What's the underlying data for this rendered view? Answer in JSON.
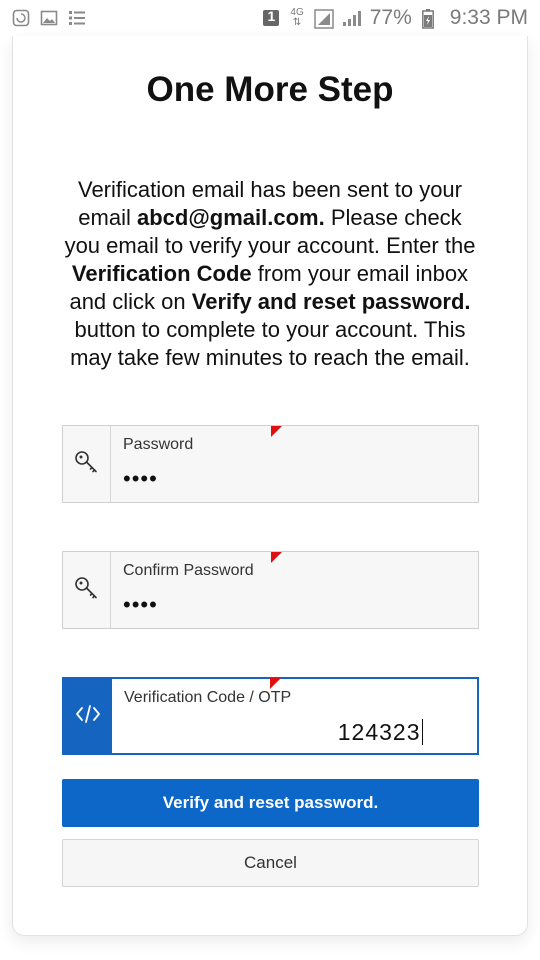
{
  "status_bar": {
    "network": "4G",
    "battery": "77%",
    "time": "9:33 PM",
    "notification_badge": "1",
    "icons": [
      "screenshot-icon",
      "gallery-icon",
      "list-icon",
      "notification-badge-icon",
      "network-4g-icon",
      "signal-icon",
      "battery-icon"
    ]
  },
  "page": {
    "title": "One More Step",
    "message": {
      "p1": "Verification email has been sent to your email ",
      "email": "abcd@gmail.com.",
      "p2": " Please check you email to verify your account. Enter the ",
      "code_label": "Verification Code",
      "p3": " from your email inbox and click on ",
      "button_ref": "Verify and reset password.",
      "p4": " button to complete to your account. This may take few minutes to reach the email."
    }
  },
  "form": {
    "password": {
      "label": "Password",
      "value": "••••",
      "icon": "key-icon"
    },
    "confirm_password": {
      "label": "Confirm Password",
      "value": "••••",
      "icon": "key-icon"
    },
    "otp": {
      "label": "Verification Code / OTP",
      "value": "124323",
      "icon": "code-icon"
    }
  },
  "buttons": {
    "verify": "Verify and reset password.",
    "cancel": "Cancel"
  },
  "colors": {
    "primary": "#0d67c9",
    "active_border": "#1565c0",
    "required_marker": "#e01010",
    "field_bg": "#f7f7f7"
  }
}
